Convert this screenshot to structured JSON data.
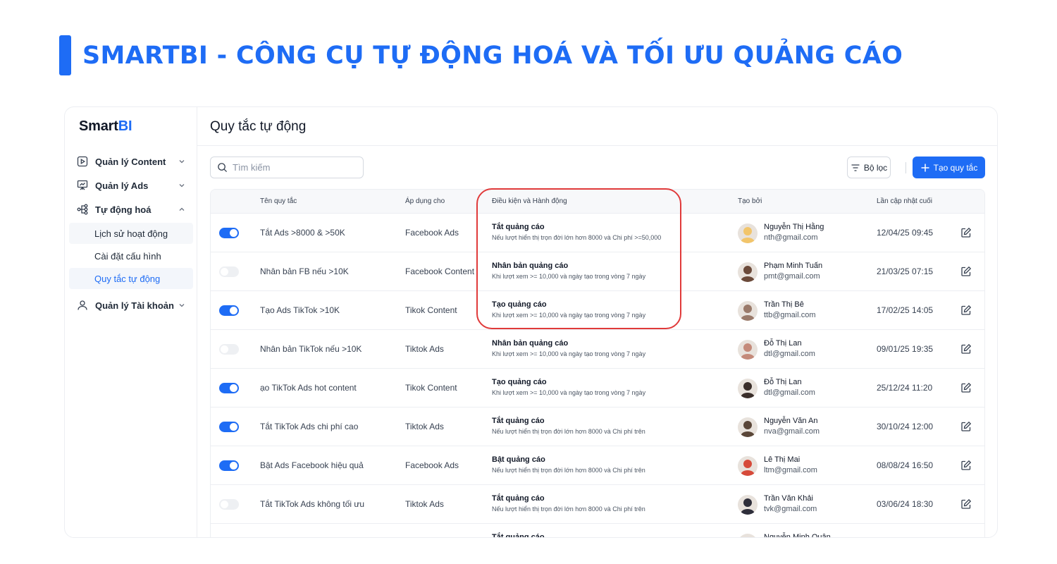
{
  "headline": "SMARTBI - CÔNG CỤ TỰ ĐỘNG HOÁ VÀ TỐI ƯU QUẢNG CÁO",
  "brand": {
    "smart": "Smart",
    "bi": "BI"
  },
  "colors": {
    "accent": "#1e6cf5",
    "highlight": "#e03a3a"
  },
  "sidebar": {
    "items": [
      {
        "label": "Quản lý Content",
        "icon": "play-square-icon",
        "expanded": false
      },
      {
        "label": "Quản lý Ads",
        "icon": "presentation-icon",
        "expanded": false
      },
      {
        "label": "Tự động hoá",
        "icon": "flow-icon",
        "expanded": true,
        "children": [
          {
            "label": "Lịch sử hoạt động"
          },
          {
            "label": "Cài đặt cấu hình"
          },
          {
            "label": "Quy tắc tự động",
            "active": true
          }
        ]
      },
      {
        "label": "Quản lý Tài khoản",
        "icon": "user-icon",
        "expanded": false
      }
    ]
  },
  "main": {
    "title": "Quy tắc tự động",
    "search_placeholder": "Tìm kiếm",
    "filter_label": "Bộ lọc",
    "create_label": "Tạo quy tắc"
  },
  "table": {
    "headers": {
      "name": "Tên quy tắc",
      "apply": "Áp dụng cho",
      "condition": "Điều kiện và Hành động",
      "creator": "Tạo bởi",
      "updated": "Lần cập nhật cuối"
    },
    "rows": [
      {
        "on": true,
        "name": "Tắt Ads >8000 & >50K",
        "apply": "Facebook Ads",
        "action": "Tắt quảng cáo",
        "desc": "Nếu lượt hiển thị trọn đời lớn hơn 8000 và Chi phí >=50,000",
        "user": "Nguyễn Thị Hằng",
        "email": "nth@gmail.com",
        "date": "12/04/25 09:45",
        "avatar": "#f2c56b"
      },
      {
        "on": false,
        "name": "Nhân bản FB nếu >10K",
        "apply": "Facebook Content",
        "action": "Nhân bản quảng cáo",
        "desc": "Khi lượt xem >= 10,000 và ngày tạo trong vòng 7 ngày",
        "user": "Phạm Minh Tuấn",
        "email": "pmt@gmail.com",
        "date": "21/03/25 07:15",
        "avatar": "#6b4a3a"
      },
      {
        "on": true,
        "name": "Tạo Ads TikTok >10K",
        "apply": "Tikok Content",
        "action": "Tạo quảng cáo",
        "desc": "Khi lượt xem >= 10,000 và ngày tạo trong vòng 7 ngày",
        "user": "Trần Thị Bê",
        "email": "ttb@gmail.com",
        "date": "17/02/25 14:05",
        "avatar": "#9a7a6a"
      },
      {
        "on": false,
        "name": "Nhân bản TikTok nếu >10K",
        "apply": "Tiktok Ads",
        "action": "Nhân bản quảng cáo",
        "desc": "Khi lượt xem >= 10,000 và ngày tạo trong vòng 7 ngày",
        "user": "Đỗ Thị Lan",
        "email": "dtl@gmail.com",
        "date": "09/01/25 19:35",
        "avatar": "#c48a7a"
      },
      {
        "on": true,
        "name": "ạo TikTok Ads hot content",
        "apply": "Tikok Content",
        "action": "Tạo quảng cáo",
        "desc": "Khi lượt xem >= 10,000 và ngày tạo trong vòng 7 ngày",
        "user": "Đỗ Thị Lan",
        "email": "dtl@gmail.com",
        "date": "25/12/24 11:20",
        "avatar": "#3a2e2a"
      },
      {
        "on": true,
        "name": "Tắt TikTok Ads chi phí cao",
        "apply": "Tiktok Ads",
        "action": "Tắt quảng cáo",
        "desc": "Nếu lượt hiển thị trọn đời lớn hơn 8000 và Chi phí trên",
        "user": "Nguyễn Văn An",
        "email": "nva@gmail.com",
        "date": "30/10/24 12:00",
        "avatar": "#5a4638"
      },
      {
        "on": true,
        "name": "Bật Ads Facebook hiệu quả",
        "apply": "Facebook Ads",
        "action": "Bật quảng cáo",
        "desc": "Nếu lượt hiển thị trọn đời lớn hơn 8000 và Chi phí trên",
        "user": "Lê Thị Mai",
        "email": "ltm@gmail.com",
        "date": "08/08/24 16:50",
        "avatar": "#d64a3a"
      },
      {
        "on": false,
        "name": "Tắt TikTok Ads không tối ưu",
        "apply": "Tiktok Ads",
        "action": "Tắt quảng cáo",
        "desc": "Nếu lượt hiển thị trọn đời lớn hơn 8000 và Chi phí trên",
        "user": "Trần Văn Khải",
        "email": "tvk@gmail.com",
        "date": "03/06/24 18:30",
        "avatar": "#2e2e3a"
      },
      {
        "on": false,
        "name": "",
        "apply": "",
        "action": "Tắt quảng cáo",
        "desc": "",
        "user": "Nguyễn Minh Quân",
        "email": "",
        "date": "",
        "avatar": "#8a7a70"
      }
    ]
  }
}
